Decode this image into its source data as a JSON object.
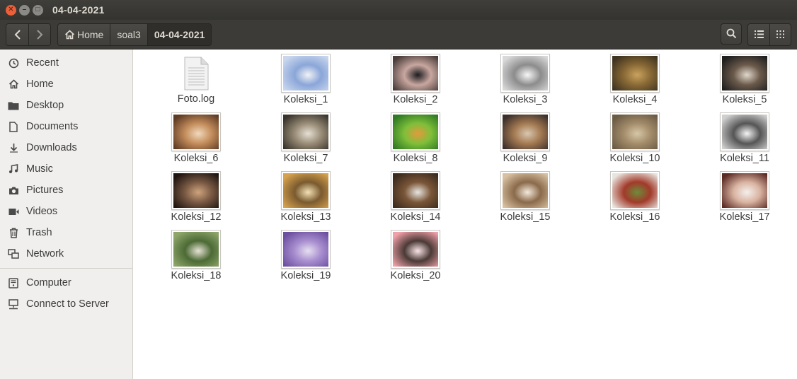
{
  "window": {
    "title": "04-04-2021"
  },
  "breadcrumbs": [
    {
      "label": "Home",
      "icon": "home-icon"
    },
    {
      "label": "soal3"
    },
    {
      "label": "04-04-2021",
      "active": true
    }
  ],
  "sidebar": {
    "items": [
      {
        "label": "Recent",
        "icon": "clock-icon"
      },
      {
        "label": "Home",
        "icon": "home-icon"
      },
      {
        "label": "Desktop",
        "icon": "folder-icon"
      },
      {
        "label": "Documents",
        "icon": "document-icon"
      },
      {
        "label": "Downloads",
        "icon": "download-icon"
      },
      {
        "label": "Music",
        "icon": "music-icon"
      },
      {
        "label": "Pictures",
        "icon": "camera-icon"
      },
      {
        "label": "Videos",
        "icon": "video-icon"
      },
      {
        "label": "Trash",
        "icon": "trash-icon"
      },
      {
        "label": "Network",
        "icon": "network-icon"
      }
    ],
    "devices": [
      {
        "label": "Computer",
        "icon": "computer-icon"
      },
      {
        "label": "Connect to Server",
        "icon": "server-icon"
      }
    ]
  },
  "files": [
    {
      "name": "Foto.log",
      "kind": "text-document"
    },
    {
      "name": "Koleksi_1",
      "kind": "image",
      "colors": [
        "#c9d6ee",
        "#8aa6d8",
        "#f2f2f6"
      ]
    },
    {
      "name": "Koleksi_2",
      "kind": "image",
      "colors": [
        "#4b3d3a",
        "#c9a7a0",
        "#1c1c1f"
      ]
    },
    {
      "name": "Koleksi_3",
      "kind": "image",
      "colors": [
        "#d9d9d9",
        "#8c8c8c",
        "#f7f7f7"
      ]
    },
    {
      "name": "Koleksi_4",
      "kind": "image",
      "colors": [
        "#3f3320",
        "#8a6a36",
        "#c9a25e"
      ]
    },
    {
      "name": "Koleksi_5",
      "kind": "image",
      "colors": [
        "#1f1f1f",
        "#6b5a4b",
        "#e0d8cc"
      ]
    },
    {
      "name": "Koleksi_6",
      "kind": "image",
      "colors": [
        "#5e3b24",
        "#c48d5c",
        "#f1d9bc"
      ]
    },
    {
      "name": "Koleksi_7",
      "kind": "image",
      "colors": [
        "#3a352c",
        "#9a8d78",
        "#e6e0d4"
      ]
    },
    {
      "name": "Koleksi_8",
      "kind": "image",
      "colors": [
        "#2f7a23",
        "#7fbf3a",
        "#e39a3c"
      ]
    },
    {
      "name": "Koleksi_9",
      "kind": "image",
      "colors": [
        "#3b2f2a",
        "#a47a52",
        "#d9c7b0"
      ]
    },
    {
      "name": "Koleksi_10",
      "kind": "image",
      "colors": [
        "#6b5a44",
        "#a48d6b",
        "#d7c7a7"
      ]
    },
    {
      "name": "Koleksi_11",
      "kind": "image",
      "colors": [
        "#cfcfcf",
        "#555555",
        "#f5f5f5"
      ]
    },
    {
      "name": "Koleksi_12",
      "kind": "image",
      "colors": [
        "#1e1410",
        "#7a5a44",
        "#cfa47e"
      ]
    },
    {
      "name": "Koleksi_13",
      "kind": "image",
      "colors": [
        "#d6a24e",
        "#7a5a2f",
        "#f3e1b6"
      ]
    },
    {
      "name": "Koleksi_14",
      "kind": "image",
      "colors": [
        "#3c2b1d",
        "#7a5638",
        "#e8e6e1"
      ]
    },
    {
      "name": "Koleksi_15",
      "kind": "image",
      "colors": [
        "#d8c1a2",
        "#8a6a4a",
        "#f3e9db"
      ]
    },
    {
      "name": "Koleksi_16",
      "kind": "image",
      "colors": [
        "#e8e4de",
        "#a23a2a",
        "#6d8c3a"
      ]
    },
    {
      "name": "Koleksi_17",
      "kind": "image",
      "colors": [
        "#5b2a24",
        "#d9b3a1",
        "#f4f0ec"
      ]
    },
    {
      "name": "Koleksi_18",
      "kind": "image",
      "colors": [
        "#8ea66a",
        "#4c6a35",
        "#e7e3d6"
      ]
    },
    {
      "name": "Koleksi_19",
      "kind": "image",
      "colors": [
        "#6c4fa0",
        "#a98fd0",
        "#e6dff0"
      ]
    },
    {
      "name": "Koleksi_20",
      "kind": "image",
      "colors": [
        "#f0a0a8",
        "#4a3a36",
        "#fbe5e7"
      ]
    }
  ],
  "colors": {
    "titlebar": "#3c3b37",
    "close_button": "#e9603a",
    "sidebar": "#f0efed"
  }
}
